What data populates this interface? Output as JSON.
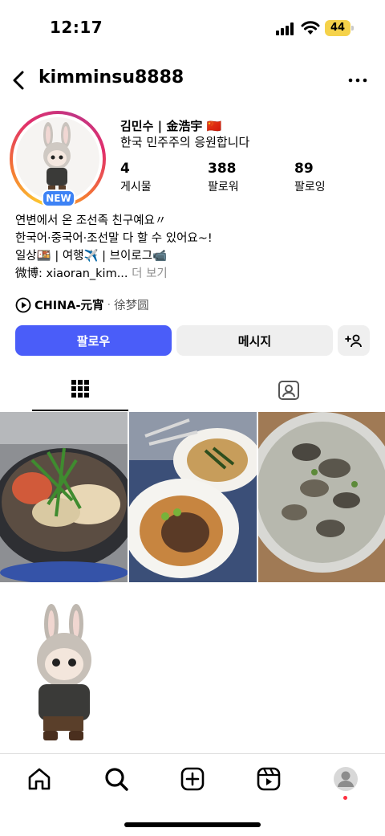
{
  "status_bar": {
    "time": "12:17",
    "battery": "44"
  },
  "header": {
    "username": "kimminsu8888"
  },
  "profile": {
    "badge": "NEW",
    "fullname": "김민수 | 金浩宇 🇨🇳",
    "tagline": "한국 민주주의 응원합니다",
    "stats": [
      {
        "value": "4",
        "label": "게시물"
      },
      {
        "value": "388",
        "label": "팔로워"
      },
      {
        "value": "89",
        "label": "팔로잉"
      }
    ],
    "bio_lines": [
      "연변에서 온 조선족 친구예요〃",
      "한국어·중국어·조선말 다 할 수 있어요~!",
      "일상🍱 | 여행✈️ | 브이로그📹"
    ],
    "bio_last": "微博: xiaoran_kim...",
    "bio_more": " 더 보기",
    "music": {
      "title": "CHINA-元宵",
      "separator": "·",
      "artist": "徐梦圆"
    }
  },
  "buttons": {
    "follow": "팔로우",
    "message": "메시지"
  },
  "colors": {
    "follow": "#4a5df9",
    "badge": "#3d82f5",
    "battery": "#f5d24a"
  }
}
